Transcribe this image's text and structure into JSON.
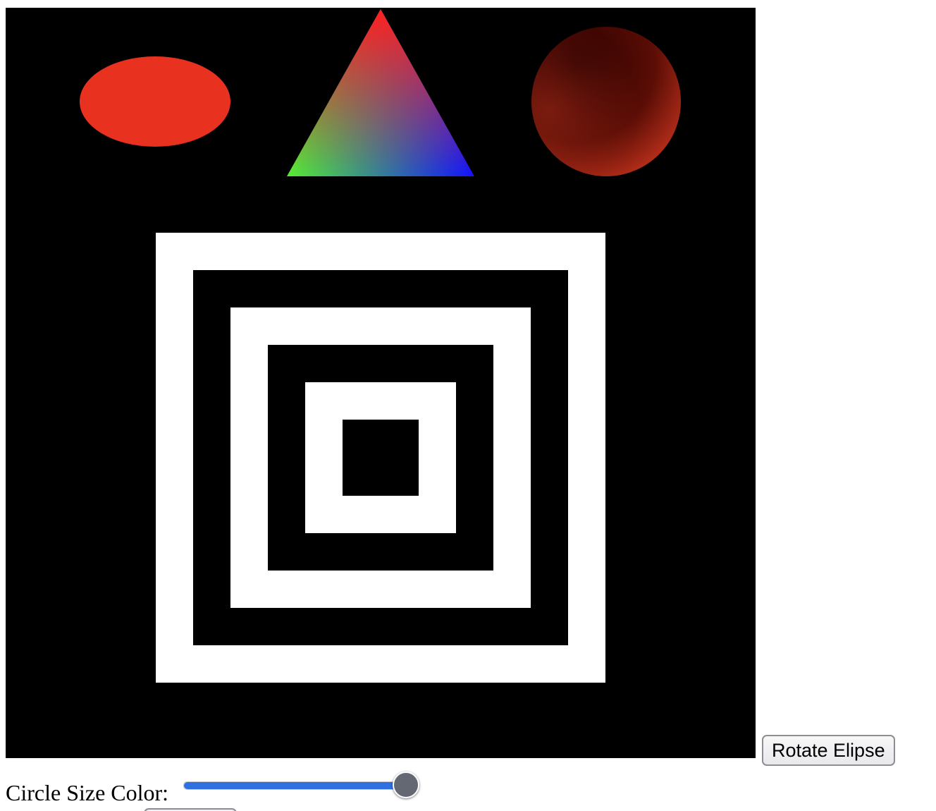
{
  "controls": {
    "rotate_button_label": "Rotate Elipse",
    "circle_slider_label": "Circle Size Color:",
    "circle_slider_value": 1.0
  },
  "scene": {
    "background_color": "#000000",
    "ellipse_color": "#e8321f",
    "triangle_colors": [
      "#ff2020",
      "#55ee33",
      "#1111ff"
    ],
    "circle_colors": [
      "#3a0000",
      "#d83a22"
    ],
    "nested_square_colors": [
      "#ffffff",
      "#000000",
      "#ffffff",
      "#000000",
      "#ffffff",
      "#000000"
    ]
  }
}
